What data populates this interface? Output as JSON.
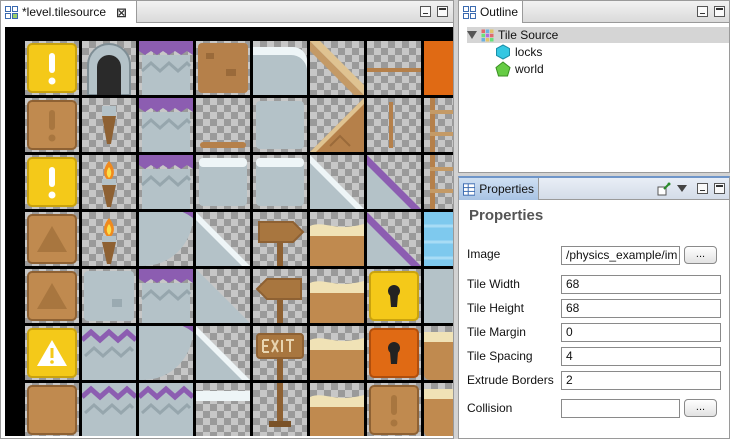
{
  "editor": {
    "tab_title": "*level.tilesource",
    "close_symbol": "⊠"
  },
  "outline": {
    "tab_title": "Outline",
    "root": "Tile Source",
    "children": [
      "locks",
      "world"
    ]
  },
  "properties": {
    "tab_title": "Properties",
    "heading": "Properties",
    "fields": {
      "image": {
        "label": "Image",
        "value": "/physics_example/im"
      },
      "tile_width": {
        "label": "Tile Width",
        "value": "68"
      },
      "tile_height": {
        "label": "Tile Height",
        "value": "68"
      },
      "tile_margin": {
        "label": "Tile Margin",
        "value": "0"
      },
      "tile_spacing": {
        "label": "Tile Spacing",
        "value": "4"
      },
      "extrude_borders": {
        "label": "Extrude Borders",
        "value": "2"
      },
      "collision": {
        "label": "Collision",
        "value": ""
      }
    },
    "browse_label": "..."
  },
  "colors": {
    "accent": "#a8c3e4",
    "yellow": "#f4c919",
    "brown": "#c08a4f",
    "purple": "#8c5db1",
    "orange": "#e06a14",
    "locks_icon": "#34c7e2",
    "world_icon": "#66cc44"
  },
  "tiles": [
    [
      "yellow-block-exclamation",
      "stone-arch-door",
      "purple-topped-stone",
      "brown-dirt-block",
      "snow-stone-corner",
      "wood-plank-diagonal",
      "wood-rail",
      "orange-block"
    ],
    [
      "brown-block-exclamation",
      "torch-unlit",
      "purple-topped-stone",
      "wood-plank",
      "stone-block",
      "dirt-slope",
      "wood-post",
      "wood-ladder"
    ],
    [
      "yellow-block-exclamation",
      "torch-lit",
      "purple-topped-stone",
      "snow-stone-block",
      "snow-stone-block",
      "snow-slope",
      "purple-slope",
      "wood-ladder"
    ],
    [
      "brown-block-warning",
      "torch-lit",
      "purple-stone-curve",
      "snow-slope",
      "wood-sign-right",
      "sand-top",
      "purple-slope",
      "water"
    ],
    [
      "brown-block-warning",
      "gray-stone-block",
      "purple-topped-stone",
      "stone-slope",
      "wood-sign-left",
      "sand-top",
      "yellow-lock-block",
      "gray-stone"
    ],
    [
      "yellow-block-warning",
      "purple-zigzag-stone",
      "purple-stone-curve",
      "snow-slope",
      "wood-sign-exit",
      "sand-top",
      "orange-lock-block",
      "sand-edge"
    ],
    [
      "brown-block-plain",
      "purple-zigzag-stone",
      "purple-zigzag-stone",
      "snow-top",
      "wood-sign-post",
      "sand-top",
      "brown-block-exclamation",
      "sand-edge"
    ]
  ]
}
